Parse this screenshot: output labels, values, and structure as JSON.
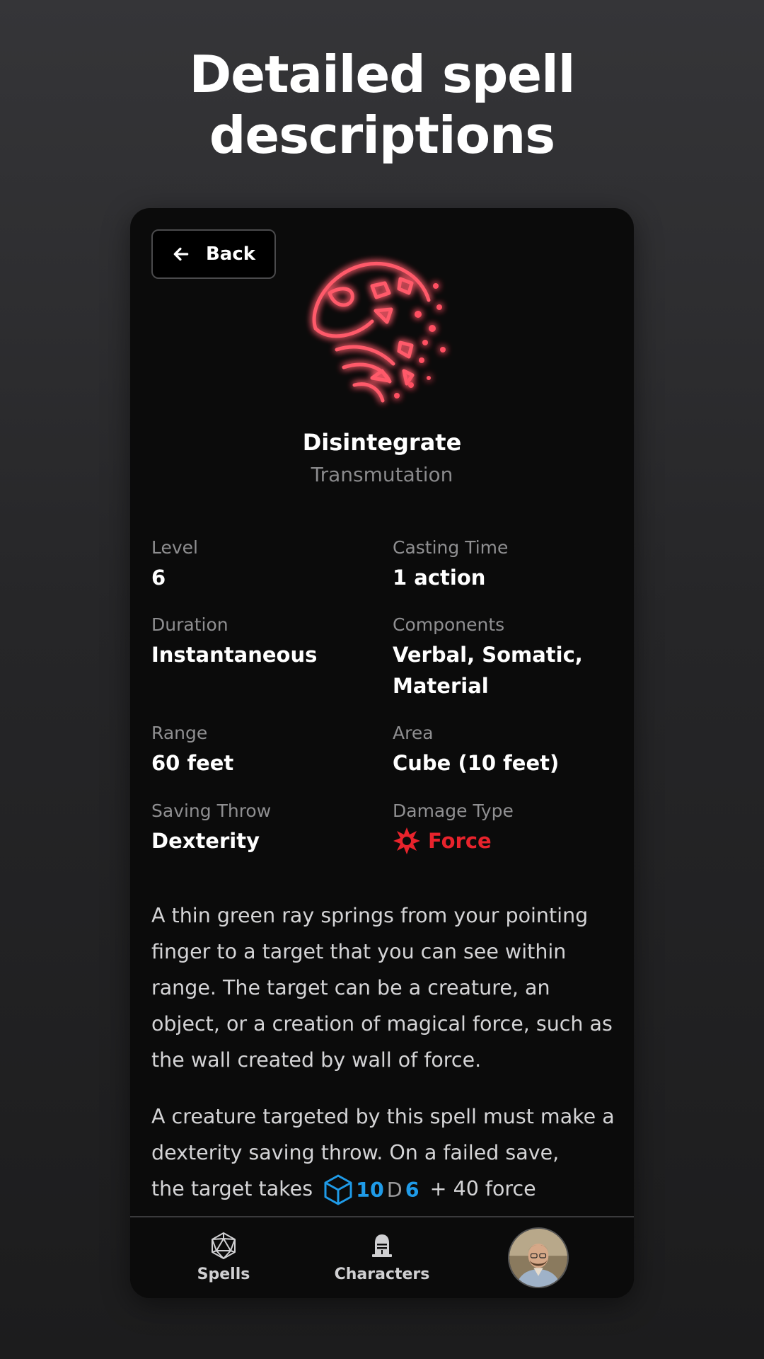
{
  "headline": {
    "line1": "Detailed spell",
    "line2": "descriptions"
  },
  "back_button": {
    "label": "Back"
  },
  "spell": {
    "name": "Disintegrate",
    "school": "Transmutation"
  },
  "stats": {
    "level": {
      "label": "Level",
      "value": "6"
    },
    "casting_time": {
      "label": "Casting Time",
      "value": "1 action"
    },
    "duration": {
      "label": "Duration",
      "value": "Instantaneous"
    },
    "components": {
      "label": "Components",
      "value_line1": "Verbal, Somatic,",
      "value_line2": "Material"
    },
    "range": {
      "label": "Range",
      "value": "60 feet"
    },
    "area": {
      "label": "Area",
      "value": "Cube (10 feet)"
    },
    "saving_throw": {
      "label": "Saving Throw",
      "value": "Dexterity"
    },
    "damage_type": {
      "label": "Damage Type",
      "value": "Force",
      "icon": "force-burst-icon",
      "color": "#e8232c"
    }
  },
  "description": {
    "p1": "A thin green ray springs from your pointing finger to a target that you can see within range. The target can be a creature, an object, or a creation of magical force, such as the wall created by wall of force.",
    "p2_line1": "A creature targeted by this spell must make a dexterity saving throw. On a failed save,",
    "p2_prefix": "the target takes",
    "dice_count": "10",
    "dice_d": "D",
    "dice_sides": "6",
    "p2_suffix": "+ 40 force"
  },
  "nav": {
    "spells": {
      "label": "Spells",
      "icon": "d20-icon"
    },
    "characters": {
      "label": "Characters",
      "icon": "knight-helmet-icon"
    },
    "profile": {
      "icon": "avatar"
    }
  },
  "colors": {
    "accent_blue": "#1f9be8",
    "force_red": "#e8232c"
  }
}
